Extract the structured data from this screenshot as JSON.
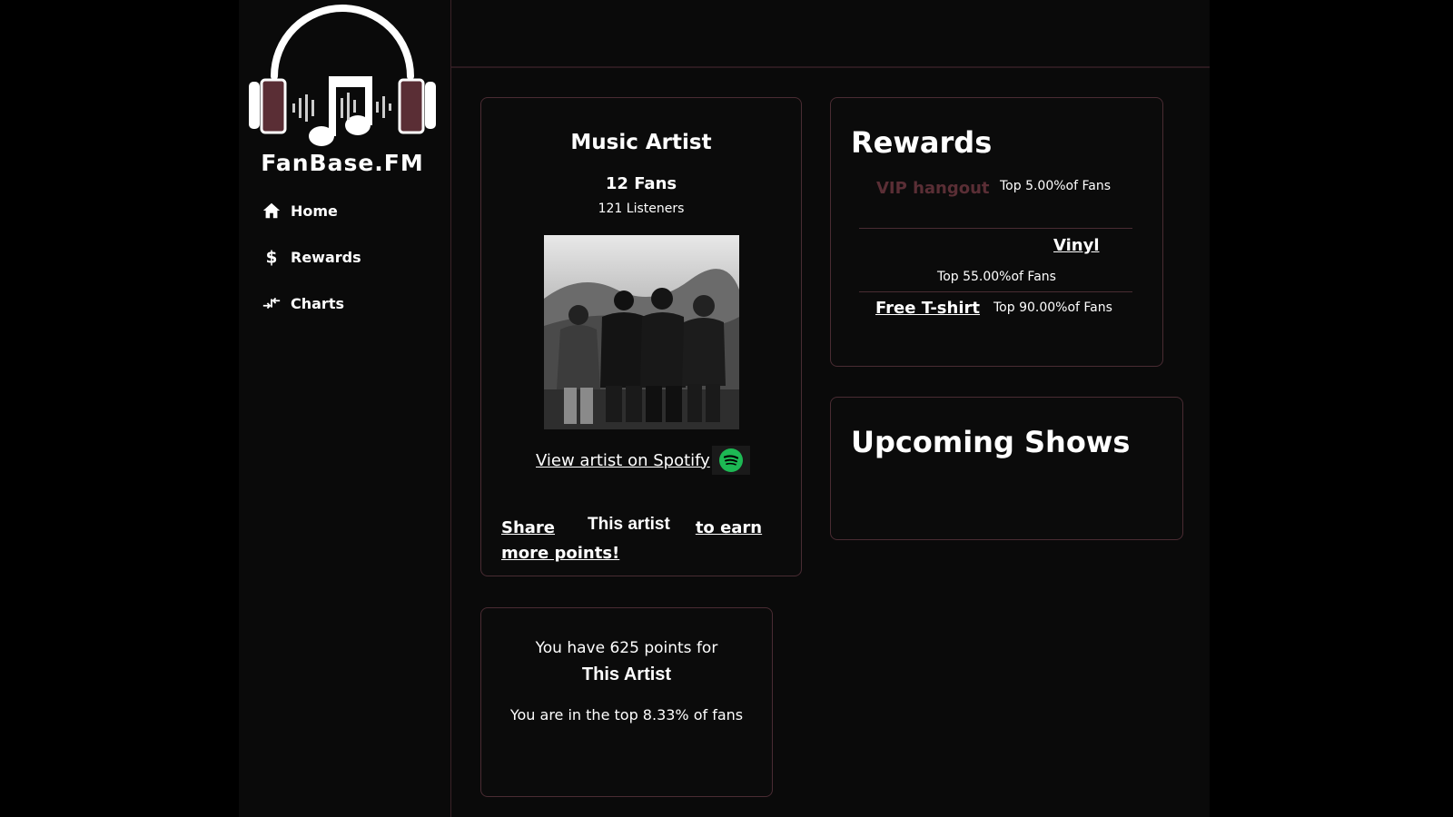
{
  "brand": {
    "name": "FanBase.FM"
  },
  "nav": {
    "items": [
      {
        "label": "Home",
        "icon": "home-icon"
      },
      {
        "label": "Rewards",
        "icon": "dollar-icon"
      },
      {
        "label": "Charts",
        "icon": "compare-arrows-icon"
      }
    ]
  },
  "artist": {
    "name": "Music Artist",
    "fans": "12 Fans",
    "listeners": "121 Listeners",
    "spotify_link": "View artist on Spotify",
    "share_prefix": "Share",
    "share_artist": "This artist",
    "share_suffix_1": "to earn",
    "share_suffix_2": "more points!"
  },
  "points": {
    "line1": "You have 625 points for",
    "artist": "This Artist",
    "rank": "You are in the top 8.33% of fans"
  },
  "rewards": {
    "title": "Rewards",
    "items": [
      {
        "name": "VIP hangout",
        "pct": "Top 5.00%of Fans",
        "color": "#5a2e35"
      },
      {
        "name": "Vinyl",
        "pct": "Top 55.00%of Fans",
        "color": "#ffffff"
      },
      {
        "name": "Free T-shirt",
        "pct": "Top 90.00%of Fans",
        "color": "#ffffff"
      }
    ]
  },
  "shows": {
    "title": "Upcoming Shows"
  },
  "colors": {
    "accent": "#5a2e35",
    "spotify": "#1db954",
    "border": "#4a2c33"
  }
}
